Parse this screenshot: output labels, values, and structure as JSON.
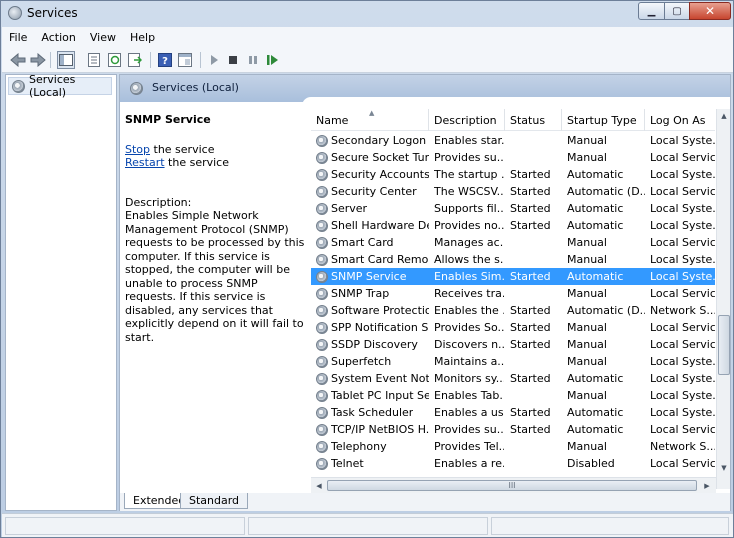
{
  "window": {
    "title": "Services",
    "minimize": "▁",
    "maximize": "▢",
    "close": "✕"
  },
  "menu": [
    "File",
    "Action",
    "View",
    "Help"
  ],
  "tree": {
    "item": "Services (Local)"
  },
  "header": {
    "title": "Services (Local)"
  },
  "detail": {
    "service_name": "SNMP Service",
    "stop_link": "Stop",
    "stop_suffix": " the service",
    "restart_link": "Restart",
    "restart_suffix": " the service",
    "description_label": "Description:",
    "description": "Enables Simple Network Management Protocol (SNMP) requests to be processed by this computer. If this service is stopped, the computer will be unable to process SNMP requests. If this service is disabled, any services that explicitly depend on it will fail to start."
  },
  "columns": [
    "Name",
    "Description",
    "Status",
    "Startup Type",
    "Log On As"
  ],
  "rows": [
    {
      "name": "Secondary Logon",
      "desc": "Enables star...",
      "status": "",
      "startup": "Manual",
      "logon": "Local Syste..."
    },
    {
      "name": "Secure Socket Tun...",
      "desc": "Provides su...",
      "status": "",
      "startup": "Manual",
      "logon": "Local Service"
    },
    {
      "name": "Security Accounts...",
      "desc": "The startup ...",
      "status": "Started",
      "startup": "Automatic",
      "logon": "Local Syste..."
    },
    {
      "name": "Security Center",
      "desc": "The WSCSV...",
      "status": "Started",
      "startup": "Automatic (D...",
      "logon": "Local Service"
    },
    {
      "name": "Server",
      "desc": "Supports fil...",
      "status": "Started",
      "startup": "Automatic",
      "logon": "Local Syste..."
    },
    {
      "name": "Shell Hardware De...",
      "desc": "Provides no...",
      "status": "Started",
      "startup": "Automatic",
      "logon": "Local Syste..."
    },
    {
      "name": "Smart Card",
      "desc": "Manages ac...",
      "status": "",
      "startup": "Manual",
      "logon": "Local Service"
    },
    {
      "name": "Smart Card Remo...",
      "desc": "Allows the s...",
      "status": "",
      "startup": "Manual",
      "logon": "Local Syste..."
    },
    {
      "name": "SNMP Service",
      "desc": "Enables Sim...",
      "status": "Started",
      "startup": "Automatic",
      "logon": "Local Syste...",
      "selected": true
    },
    {
      "name": "SNMP Trap",
      "desc": "Receives tra...",
      "status": "",
      "startup": "Manual",
      "logon": "Local Service"
    },
    {
      "name": "Software Protection",
      "desc": "Enables the ...",
      "status": "Started",
      "startup": "Automatic (D...",
      "logon": "Network S..."
    },
    {
      "name": "SPP Notification S...",
      "desc": "Provides So...",
      "status": "Started",
      "startup": "Manual",
      "logon": "Local Service"
    },
    {
      "name": "SSDP Discovery",
      "desc": "Discovers n...",
      "status": "Started",
      "startup": "Manual",
      "logon": "Local Service"
    },
    {
      "name": "Superfetch",
      "desc": "Maintains a...",
      "status": "",
      "startup": "Manual",
      "logon": "Local Syste..."
    },
    {
      "name": "System Event Noti...",
      "desc": "Monitors sy...",
      "status": "Started",
      "startup": "Automatic",
      "logon": "Local Syste..."
    },
    {
      "name": "Tablet PC Input Se...",
      "desc": "Enables Tab...",
      "status": "",
      "startup": "Manual",
      "logon": "Local Syste..."
    },
    {
      "name": "Task Scheduler",
      "desc": "Enables a us...",
      "status": "Started",
      "startup": "Automatic",
      "logon": "Local Syste..."
    },
    {
      "name": "TCP/IP NetBIOS H...",
      "desc": "Provides su...",
      "status": "Started",
      "startup": "Automatic",
      "logon": "Local Service"
    },
    {
      "name": "Telephony",
      "desc": "Provides Tel...",
      "status": "",
      "startup": "Manual",
      "logon": "Network S..."
    },
    {
      "name": "Telnet",
      "desc": "Enables a re...",
      "status": "",
      "startup": "Disabled",
      "logon": "Local Service"
    }
  ],
  "scroll": {
    "h_thumb_grip": "III"
  },
  "tabs": [
    "Extended",
    "Standard"
  ],
  "colors": {
    "selection": "#3399ff",
    "link": "#0645ad"
  }
}
